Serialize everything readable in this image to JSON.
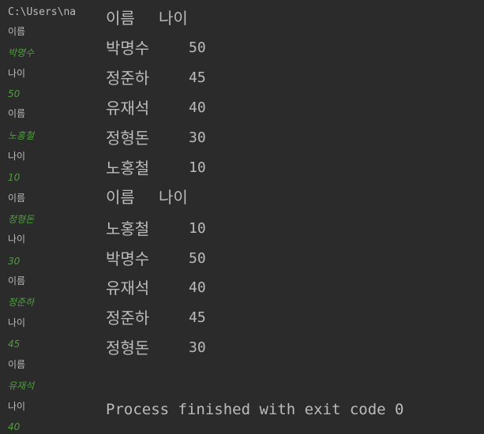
{
  "console": {
    "path": "C:\\Users\\na",
    "input_log": [
      {
        "prompt": "이름",
        "value": "박명수"
      },
      {
        "prompt": "나이",
        "value": "50"
      },
      {
        "prompt": "이름",
        "value": "노홍철"
      },
      {
        "prompt": "나이",
        "value": "10"
      },
      {
        "prompt": "이름",
        "value": "정형돈"
      },
      {
        "prompt": "나이",
        "value": "30"
      },
      {
        "prompt": "이름",
        "value": "정준하"
      },
      {
        "prompt": "나이",
        "value": "45"
      },
      {
        "prompt": "이름",
        "value": "유재석"
      },
      {
        "prompt": "나이",
        "value": "40"
      }
    ],
    "tables": [
      {
        "header": {
          "name": "이름",
          "age": "나이"
        },
        "rows": [
          {
            "name": "박명수",
            "age": "50"
          },
          {
            "name": "정준하",
            "age": "45"
          },
          {
            "name": "유재석",
            "age": "40"
          },
          {
            "name": "정형돈",
            "age": "30"
          },
          {
            "name": "노홍철",
            "age": "10"
          }
        ]
      },
      {
        "header": {
          "name": "이름",
          "age": "나이"
        },
        "rows": [
          {
            "name": "노홍철",
            "age": "10"
          },
          {
            "name": "박명수",
            "age": "50"
          },
          {
            "name": "유재석",
            "age": "40"
          },
          {
            "name": "정준하",
            "age": "45"
          },
          {
            "name": "정형돈",
            "age": "30"
          }
        ]
      }
    ],
    "finish_message": "Process finished with exit code 0"
  }
}
